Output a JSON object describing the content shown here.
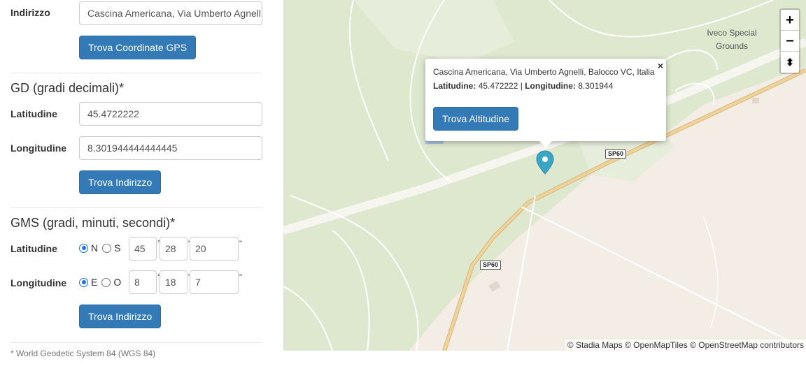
{
  "address": {
    "label": "Indirizzo",
    "value": "Cascina Americana, Via Umberto Agnelli, Balocco VC, Italia",
    "button": "Trova Coordinate GPS"
  },
  "gd": {
    "title": "GD (gradi decimali)*",
    "lat_label": "Latitudine",
    "lat_value": "45.4722222",
    "lon_label": "Longitudine",
    "lon_value": "8.301944444444445",
    "button": "Trova Indirizzo"
  },
  "gms": {
    "title": "GMS (gradi, minuti, secondi)*",
    "lat_label": "Latitudine",
    "lat_dir_n": "N",
    "lat_dir_s": "S",
    "lat_deg": "45",
    "lat_min": "28",
    "lat_sec": "20",
    "lon_label": "Longitudine",
    "lon_dir_e": "E",
    "lon_dir_o": "O",
    "lon_deg": "8",
    "lon_min": "18",
    "lon_sec": "7",
    "deg_sym": "°",
    "min_sym": "'",
    "sec_sym": "\"",
    "button": "Trova Indirizzo"
  },
  "footnote": "* World Geodetic System 84 (WGS 84)",
  "map": {
    "zoom_in": "+",
    "zoom_out": "−",
    "reset_north": "⬍",
    "popup": {
      "address": "Cascina Americana, Via Umberto Agnelli, Balocco VC, Italia",
      "lat_label": "Latitudine:",
      "lat_value": "45.472222",
      "separator": "|",
      "lon_label": "Longitudine:",
      "lon_value": "8.301944",
      "button": "Trova Altitudine",
      "close": "×"
    },
    "road_label_1": "SP60",
    "road_label_2": "SP60",
    "place_label": "Iveco Special Grounds",
    "attribution": "© Stadia Maps © OpenMapTiles © OpenStreetMap contributors",
    "colors": {
      "land": "#f3ede5",
      "green": "#dde8cf",
      "road_main": "#e7c98a",
      "marker": "#3aa6c5",
      "button": "#337ab7"
    }
  }
}
